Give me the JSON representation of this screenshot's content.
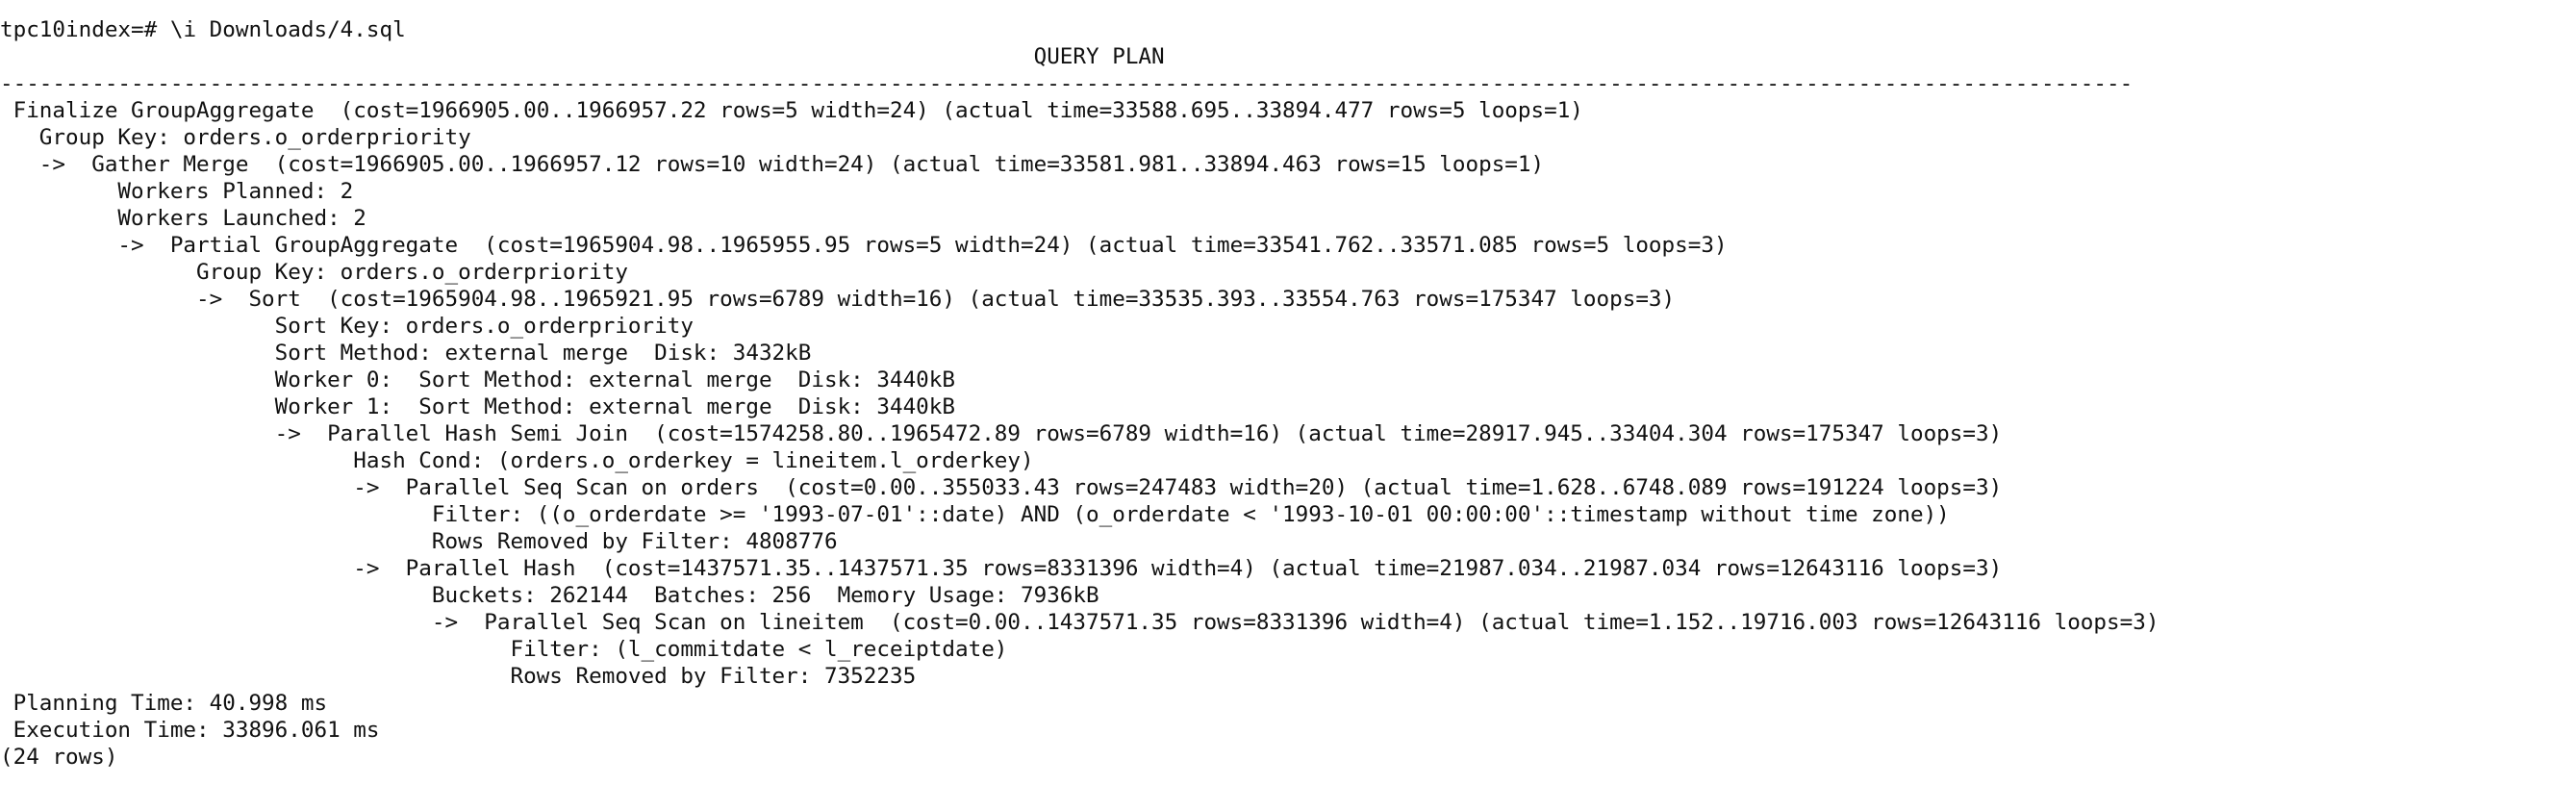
{
  "terminal": {
    "prompt": "tpc10index=# ",
    "command": "\\i Downloads/4.sql",
    "header": "                                                                               QUERY PLAN",
    "separator": "-------------------------------------------------------------------------------------------------------------------------------------------------------------------",
    "plan_lines": [
      " Finalize GroupAggregate  (cost=1966905.00..1966957.22 rows=5 width=24) (actual time=33588.695..33894.477 rows=5 loops=1)",
      "   Group Key: orders.o_orderpriority",
      "   ->  Gather Merge  (cost=1966905.00..1966957.12 rows=10 width=24) (actual time=33581.981..33894.463 rows=15 loops=1)",
      "         Workers Planned: 2",
      "         Workers Launched: 2",
      "         ->  Partial GroupAggregate  (cost=1965904.98..1965955.95 rows=5 width=24) (actual time=33541.762..33571.085 rows=5 loops=3)",
      "               Group Key: orders.o_orderpriority",
      "               ->  Sort  (cost=1965904.98..1965921.95 rows=6789 width=16) (actual time=33535.393..33554.763 rows=175347 loops=3)",
      "                     Sort Key: orders.o_orderpriority",
      "                     Sort Method: external merge  Disk: 3432kB",
      "                     Worker 0:  Sort Method: external merge  Disk: 3440kB",
      "                     Worker 1:  Sort Method: external merge  Disk: 3440kB",
      "                     ->  Parallel Hash Semi Join  (cost=1574258.80..1965472.89 rows=6789 width=16) (actual time=28917.945..33404.304 rows=175347 loops=3)",
      "                           Hash Cond: (orders.o_orderkey = lineitem.l_orderkey)",
      "                           ->  Parallel Seq Scan on orders  (cost=0.00..355033.43 rows=247483 width=20) (actual time=1.628..6748.089 rows=191224 loops=3)",
      "                                 Filter: ((o_orderdate >= '1993-07-01'::date) AND (o_orderdate < '1993-10-01 00:00:00'::timestamp without time zone))",
      "                                 Rows Removed by Filter: 4808776",
      "                           ->  Parallel Hash  (cost=1437571.35..1437571.35 rows=8331396 width=4) (actual time=21987.034..21987.034 rows=12643116 loops=3)",
      "                                 Buckets: 262144  Batches: 256  Memory Usage: 7936kB",
      "                                 ->  Parallel Seq Scan on lineitem  (cost=0.00..1437571.35 rows=8331396 width=4) (actual time=1.152..19716.003 rows=12643116 loops=3)",
      "                                       Filter: (l_commitdate < l_receiptdate)",
      "                                       Rows Removed by Filter: 7352235",
      " Planning Time: 40.998 ms",
      " Execution Time: 33896.061 ms"
    ],
    "row_count": "(24 rows)"
  }
}
